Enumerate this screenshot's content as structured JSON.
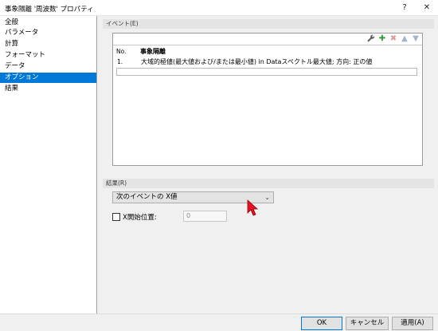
{
  "window": {
    "title": "事象隔離 '周波数' プロパティ",
    "help_label": "?",
    "close_label": "✕"
  },
  "sidebar": {
    "items": [
      {
        "label": "全般"
      },
      {
        "label": "パラメータ"
      },
      {
        "label": "計算"
      },
      {
        "label": "フォーマット"
      },
      {
        "label": "データ"
      },
      {
        "label": "オプション"
      },
      {
        "label": "結果"
      }
    ],
    "selected_label": "オプション"
  },
  "events_section": {
    "header": "イベント(E)",
    "toolbar_icons": [
      "wrench-icon",
      "add-icon",
      "delete-icon",
      "move-up-icon",
      "move-down-icon"
    ],
    "columns": {
      "no": "No.",
      "name": "事象隔離"
    },
    "rows": [
      {
        "no": "1.",
        "description": "大域的極値(最大値および/または最小値) in Dataスペクトル最大値; 方向: 正の値"
      }
    ]
  },
  "results_section": {
    "header": "結果(R)",
    "dropdown_value": "次のイベントの X値",
    "checkbox_label": "X開始位置:",
    "checkbox_checked": false,
    "x_start_value": "0"
  },
  "footer": {
    "ok_label": "OK",
    "cancel_label": "キャンセル",
    "apply_label": "適用(A)"
  },
  "colors": {
    "selection": "#0078d7",
    "add_icon": "#2e9b38",
    "delete_icon": "#c0392b",
    "cursor": "#e81123"
  }
}
